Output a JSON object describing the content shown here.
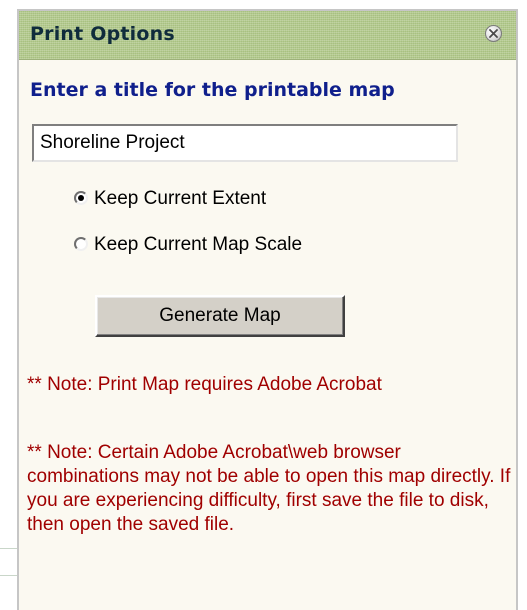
{
  "panel": {
    "title": "Print Options",
    "close_icon": "close-circle-icon"
  },
  "form": {
    "prompt": "Enter a title for the printable map",
    "title_value": "Shoreline Project",
    "options": [
      {
        "label": "Keep Current Extent",
        "checked": true
      },
      {
        "label": "Keep Current Map Scale",
        "checked": false
      }
    ],
    "generate_label": "Generate Map"
  },
  "notes": [
    "** Note: Print Map requires Adobe Acrobat",
    "** Note: Certain Adobe Acrobat\\web browser combinations may not be able to open this map directly. If you are experiencing difficulty, first save the file to disk, then open the saved file."
  ],
  "colors": {
    "titlebar": "#b2c98c",
    "title_text": "#102c3c",
    "prompt_text": "#0f1f8c",
    "note_text": "#a00000",
    "panel_bg": "#fbf9f1"
  }
}
